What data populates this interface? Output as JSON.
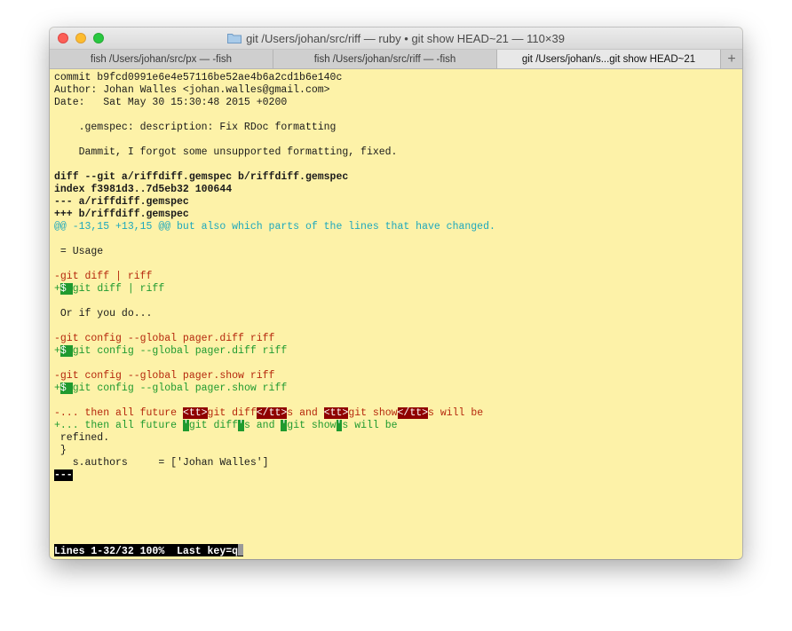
{
  "window": {
    "title": "git  /Users/johan/src/riff — ruby • git show HEAD~21 — 110×39"
  },
  "tabs": [
    {
      "label": "fish  /Users/johan/src/px — -fish"
    },
    {
      "label": "fish  /Users/johan/src/riff — -fish"
    },
    {
      "label": "git  /Users/johan/s...git show HEAD~21"
    }
  ],
  "tab_add_label": "+",
  "terminal": {
    "commit": "commit b9fcd0991e6e4e57116be52ae4b6a2cd1b6e140c",
    "author": "Author: Johan Walles <johan.walles@gmail.com>",
    "date": "Date:   Sat May 30 15:30:48 2015 +0200",
    "subject": "    .gemspec: description: Fix RDoc formatting",
    "body": "    Dammit, I forgot some unsupported formatting, fixed.",
    "diff_header": "diff --git a/riffdiff.gemspec b/riffdiff.gemspec",
    "index": "index f3981d3..7d5eb32 100644",
    "minus_file": "--- a/riffdiff.gemspec",
    "plus_file": "+++ b/riffdiff.gemspec",
    "hunk": "@@ -13,15 +13,15 @@ but also which parts of the lines that have changed.",
    "ctx_usage": " = Usage",
    "del1": "-git diff | riff",
    "add1_prefix": "+",
    "add1_hl": "$ ",
    "add1_rest": "git diff | riff",
    "ctx_or": " Or if you do...",
    "del2": "-git config --global pager.diff riff",
    "add2_prefix": "+",
    "add2_hl": "$ ",
    "add2_rest": "git config --global pager.diff riff",
    "del3": "-git config --global pager.show riff",
    "add3_prefix": "+",
    "add3_hl": "$ ",
    "add3_rest": "git config --global pager.show riff",
    "del4_a": "-... then all future ",
    "del4_tt1": "<tt>",
    "del4_b": "git diff",
    "del4_tt2": "</tt>",
    "del4_c": "s and ",
    "del4_tt3": "<tt>",
    "del4_d": "git show",
    "del4_tt4": "</tt>",
    "del4_e": "s will be",
    "add4_a": "+... then all future ",
    "add4_q1": "'",
    "add4_b": "git diff",
    "add4_q2": "'",
    "add4_c": "s and ",
    "add4_q3": "'",
    "add4_d": "git show",
    "add4_q4": "'",
    "add4_e": "s will be",
    "ctx_refined": " refined.",
    "ctx_brace": " }",
    "ctx_authors": "   s.authors     = ['Johan Walles']",
    "separator": "---",
    "status": "Lines 1-32/32 100%  Last key=q"
  }
}
